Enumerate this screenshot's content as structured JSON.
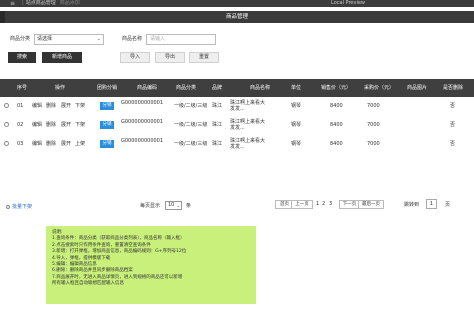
{
  "topbar": {
    "breadcrumb": "站点商品管理",
    "breadcrumb_sub": "商品添加",
    "hostname": "Local Preview"
  },
  "title": "商品管理",
  "filters": {
    "category_label": "商品分类",
    "category_value": "请选择",
    "name_label": "商品名称",
    "name_placeholder": "请输入"
  },
  "buttons": {
    "search": "搜索",
    "add": "新增商品",
    "import": "导入",
    "export": "导出",
    "reset": "重置"
  },
  "table": {
    "headers": [
      "序号",
      "操作",
      "团购分销",
      "商品编码",
      "商品分类",
      "品牌",
      "商品名称",
      "单位",
      "销售价（元）",
      "采购价（元）",
      "商品图片",
      "是否删除"
    ],
    "rows": [
      {
        "index": "01",
        "actions": [
          "编辑",
          "删除",
          "展开",
          "下架"
        ],
        "tag": "分销",
        "code": "G000000000001",
        "category": "一级/二级/三级",
        "brand": "珠江",
        "name": "珠江啊上来看大发发...",
        "unit": "钢琴",
        "price": "8400",
        "cost": "7000",
        "image": "",
        "deleted": "否"
      },
      {
        "index": "02",
        "actions": [
          "编辑",
          "删除",
          "展开",
          "下架"
        ],
        "tag": "分销",
        "code": "G000000000001",
        "category": "一级/二级/三级",
        "brand": "珠江",
        "name": "珠江啊上来看大发发...",
        "unit": "钢琴",
        "price": "8400",
        "cost": "7000",
        "image": "",
        "deleted": "否"
      },
      {
        "index": "03",
        "actions": [
          "编辑",
          "删除",
          "展开",
          "上架"
        ],
        "tag": "分销",
        "code": "G000000000001",
        "category": "一级/二级/三级",
        "brand": "珠江",
        "name": "珠江啊上来看大发发...",
        "unit": "钢琴",
        "price": "8400",
        "cost": "7000",
        "image": "",
        "deleted": "否"
      }
    ]
  },
  "footer": {
    "batch": "批量下架",
    "per_page_label": "每页显示",
    "per_page_value": "10",
    "per_page_unit": "条",
    "first": "首页",
    "prev": "上一页",
    "pages": [
      "1",
      "2",
      "3"
    ],
    "next": "下一页",
    "last": "最后一页",
    "jump_label": "跳转到",
    "jump_value": "1",
    "jump_unit": "页"
  },
  "notes": [
    "说明:",
    "1.查询条件：商品分类（获取商品分类列表），商品名称（输入框）",
    "2.点击搜索时只作用条件查询，重置清空查询条件",
    "3.新增：打开弹框，增加商品信息，商品编码规则：G+序列号12位",
    "4.导入，弹框，提供模版下载",
    "5.编辑：编辑商品信息",
    "6.删除：删除商品并且同步删除商品档案",
    "7.商品展开时，无进入商品详情页，进入到规格的商品还可以新增",
    "所有输入框且自动联想匹配输入信息"
  ],
  "colors": {
    "header_bg": "#3f3f3f",
    "tag_bg": "#2a8fd8",
    "notes_bg": "#c8f07a"
  }
}
